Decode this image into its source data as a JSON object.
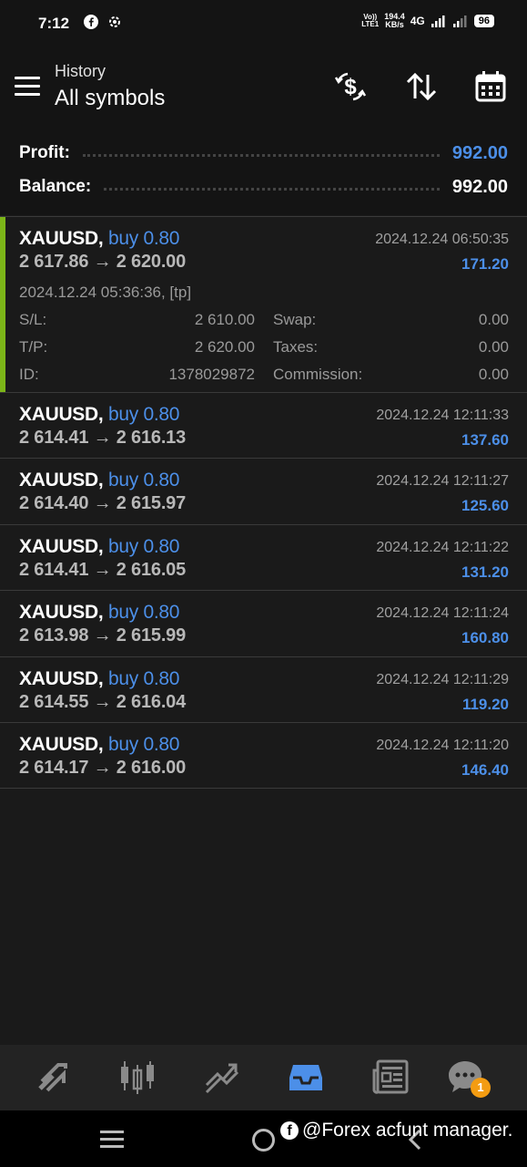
{
  "status_bar": {
    "time": "7:12",
    "volte_top": "Vo))",
    "volte_bottom": "LTE1",
    "net_speed_value": "194.4",
    "net_speed_unit": "KB/s",
    "network": "4G",
    "battery": "96"
  },
  "header": {
    "subtitle": "History",
    "title": "All symbols"
  },
  "summary": {
    "profit_label": "Profit:",
    "profit_value": "992.00",
    "balance_label": "Balance:",
    "balance_value": "992.00",
    "profit_color": "#4c8fe8"
  },
  "trades": [
    {
      "symbol": "XAUUSD,",
      "side": "buy 0.80",
      "prices": "2 617.86 → 2 620.00",
      "close_time": "2024.12.24 06:50:35",
      "profit": "171.20",
      "open_info": "2024.12.24 05:36:36, [tp]",
      "details": {
        "sl_label": "S/L:",
        "sl_value": "2 610.00",
        "swap_label": "Swap:",
        "swap_value": "0.00",
        "tp_label": "T/P:",
        "tp_value": "2 620.00",
        "taxes_label": "Taxes:",
        "taxes_value": "0.00",
        "id_label": "ID:",
        "id_value": "1378029872",
        "commission_label": "Commission:",
        "commission_value": "0.00"
      }
    },
    {
      "symbol": "XAUUSD,",
      "side": "buy 0.80",
      "prices": "2 614.41 → 2 616.13",
      "close_time": "2024.12.24 12:11:33",
      "profit": "137.60"
    },
    {
      "symbol": "XAUUSD,",
      "side": "buy 0.80",
      "prices": "2 614.40 → 2 615.97",
      "close_time": "2024.12.24 12:11:27",
      "profit": "125.60"
    },
    {
      "symbol": "XAUUSD,",
      "side": "buy 0.80",
      "prices": "2 614.41 → 2 616.05",
      "close_time": "2024.12.24 12:11:22",
      "profit": "131.20"
    },
    {
      "symbol": "XAUUSD,",
      "side": "buy 0.80",
      "prices": "2 613.98 → 2 615.99",
      "close_time": "2024.12.24 12:11:24",
      "profit": "160.80"
    },
    {
      "symbol": "XAUUSD,",
      "side": "buy 0.80",
      "prices": "2 614.55 → 2 616.04",
      "close_time": "2024.12.24 12:11:29",
      "profit": "119.20"
    },
    {
      "symbol": "XAUUSD,",
      "side": "buy 0.80",
      "prices": "2 614.17 → 2 616.00",
      "close_time": "2024.12.24 12:11:20",
      "profit": "146.40"
    }
  ],
  "bottom_nav": {
    "items": [
      "quotes-icon",
      "chart-icon",
      "trade-icon",
      "history-icon",
      "news-icon",
      "chat-icon"
    ],
    "active": "history-icon",
    "active_color": "#4c8fe8",
    "chat_badge": "1"
  },
  "watermark": {
    "text": "@Forex acfunt manager."
  },
  "colors": {
    "background": "#1a1a1a",
    "accent_green": "#7cb518",
    "buy_blue": "#4c8fe8"
  }
}
